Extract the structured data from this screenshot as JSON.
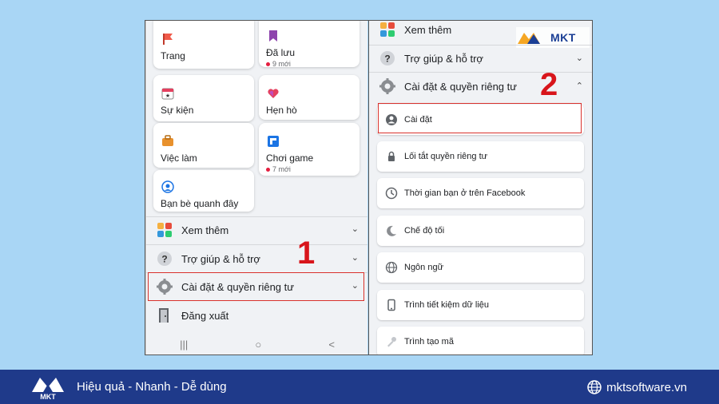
{
  "left": {
    "cards": [
      {
        "label": "Trang",
        "sub": "",
        "icon": "flag-icon"
      },
      {
        "label": "Đã lưu",
        "sub": "9 mới",
        "icon": "bookmark-icon"
      },
      {
        "label": "Sự kiện",
        "sub": "",
        "icon": "calendar-icon"
      },
      {
        "label": "Hẹn hò",
        "sub": "",
        "icon": "heart-icon"
      },
      {
        "label": "Việc làm",
        "sub": "",
        "icon": "briefcase-icon"
      },
      {
        "label": "Chơi game",
        "sub": "7 mới",
        "icon": "game-icon"
      },
      {
        "label": "Bạn bè quanh đây",
        "sub": "",
        "icon": "location-icon"
      }
    ],
    "rows": {
      "see_more": "Xem thêm",
      "help": "Trợ giúp & hỗ trợ",
      "settings_privacy": "Cài đặt & quyền riêng tư",
      "logout": "Đăng xuất"
    },
    "nav": {
      "recent": "|||",
      "home": "○",
      "back": "<"
    },
    "step": "1"
  },
  "right": {
    "rows": {
      "see_more": "Xem thêm",
      "help": "Trợ giúp & hỗ trợ",
      "settings_privacy": "Cài đặt & quyền riêng tư"
    },
    "items": [
      "Cài đặt",
      "Lối tắt quyền riêng tư",
      "Thời gian bạn ở trên Facebook",
      "Chế độ tối",
      "Ngôn ngữ",
      "Trình tiết kiệm dữ liệu",
      "Trình tạo mã"
    ],
    "step": "2",
    "watermark": "MKT"
  },
  "footer": {
    "logo_text": "MKT",
    "tagline": "Hiệu quả - Nhanh - Dễ dùng",
    "website": "mktsoftware.vn"
  },
  "colors": {
    "background": "#a9d6f5",
    "footer": "#1f3a8a",
    "highlight": "#d9312c",
    "step_number": "#d8151b"
  }
}
